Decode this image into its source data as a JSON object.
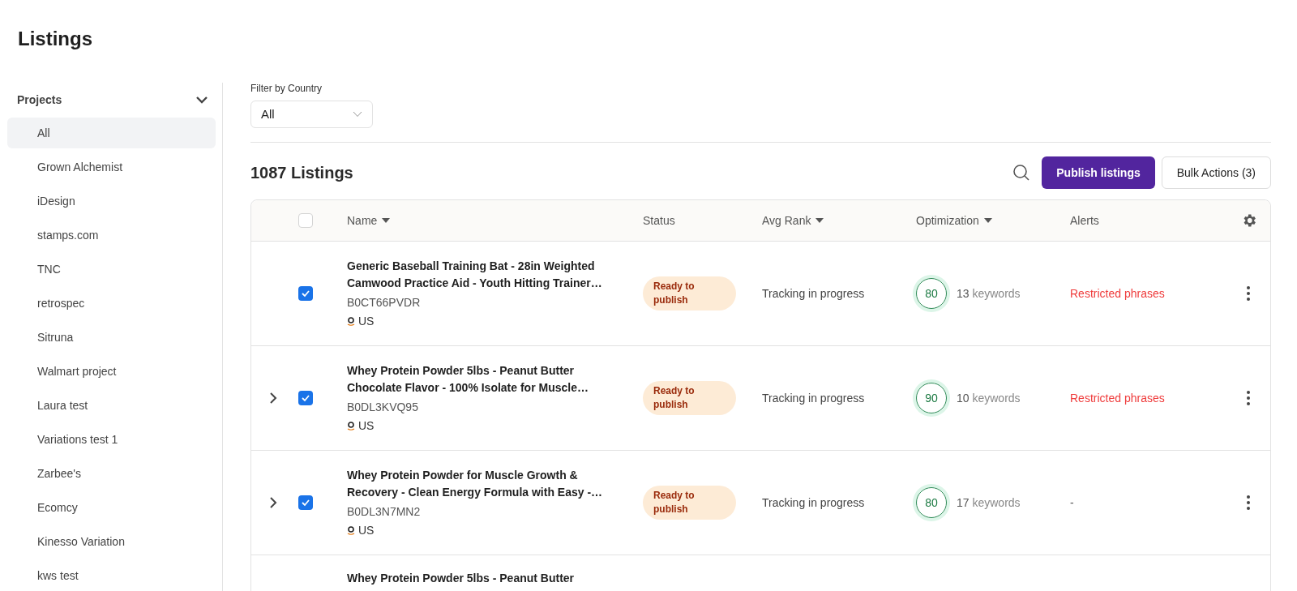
{
  "page_title": "Listings",
  "sidebar": {
    "heading": "Projects",
    "expanded": true,
    "items": [
      {
        "label": "All",
        "selected": true
      },
      {
        "label": "Grown Alchemist",
        "selected": false
      },
      {
        "label": "iDesign",
        "selected": false
      },
      {
        "label": "stamps.com",
        "selected": false
      },
      {
        "label": "TNC",
        "selected": false
      },
      {
        "label": "retrospec",
        "selected": false
      },
      {
        "label": "Sitruna",
        "selected": false
      },
      {
        "label": "Walmart project",
        "selected": false
      },
      {
        "label": "Laura test",
        "selected": false
      },
      {
        "label": "Variations test 1",
        "selected": false
      },
      {
        "label": "Zarbee's",
        "selected": false
      },
      {
        "label": "Ecomcy",
        "selected": false
      },
      {
        "label": "Kinesso Variation",
        "selected": false
      },
      {
        "label": "kws test",
        "selected": false
      }
    ]
  },
  "filter": {
    "label": "Filter by Country",
    "value": "All"
  },
  "count_title": "1087 Listings",
  "buttons": {
    "publish": "Publish listings",
    "bulk": "Bulk Actions (3)"
  },
  "table": {
    "header_checked": false,
    "columns": [
      {
        "label": "Name",
        "sortable": true
      },
      {
        "label": "Status",
        "sortable": false
      },
      {
        "label": "Avg Rank",
        "sortable": true
      },
      {
        "label": "Optimization",
        "sortable": true
      },
      {
        "label": "Alerts",
        "sortable": false
      }
    ],
    "rows": [
      {
        "expandable": false,
        "checked": true,
        "name": "Generic Baseball Training Bat - 28in Weighted Camwood Practice Aid - Youth Hitting Trainer…",
        "asin": "B0CT66PVDR",
        "marketplace": "US",
        "status": "Ready to publish",
        "avg_rank": "Tracking in progress",
        "score": "80",
        "keywords_count": "13",
        "keywords_label": "keywords",
        "alert": {
          "text": "Restricted phrases",
          "color": "#ef3b3b"
        }
      },
      {
        "expandable": true,
        "checked": true,
        "name": "Whey Protein Powder 5lbs - Peanut Butter Chocolate Flavor - 100% Isolate for Muscle…",
        "asin": "B0DL3KVQ95",
        "marketplace": "US",
        "status": "Ready to publish",
        "avg_rank": "Tracking in progress",
        "score": "90",
        "keywords_count": "10",
        "keywords_label": "keywords",
        "alert": {
          "text": "Restricted phrases",
          "color": "#ef3b3b"
        }
      },
      {
        "expandable": true,
        "checked": true,
        "name": "Whey Protein Powder for Muscle Growth & Recovery - Clean Energy Formula with Easy -…",
        "asin": "B0DL3N7MN2",
        "marketplace": "US",
        "status": "Ready to publish",
        "avg_rank": "Tracking in progress",
        "score": "80",
        "keywords_count": "17",
        "keywords_label": "keywords",
        "alert": {
          "text": "-",
          "color": "#555555"
        }
      },
      {
        "name": "Whey Protein Powder 5lbs - Peanut Butter"
      }
    ]
  }
}
